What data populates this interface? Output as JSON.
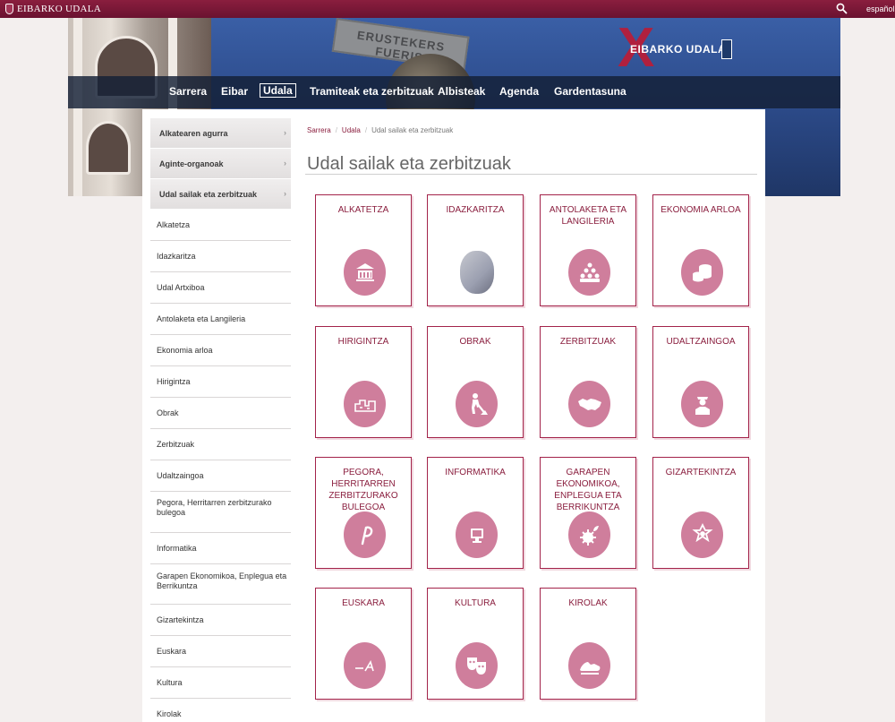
{
  "topbar": {
    "logo_text": "EIBARKO UDALA",
    "language": "español"
  },
  "banner": {
    "sign_text": "ERUSTEKERS FUERIS",
    "brand_text": "EIBARKO UDALA",
    "brand_mark": "X"
  },
  "nav": {
    "items": [
      {
        "label": "Sarrera"
      },
      {
        "label": "Eibar"
      },
      {
        "label": "Udala",
        "active": true
      },
      {
        "label": "Tramiteak eta zerbitzuak"
      },
      {
        "label": "Albisteak"
      },
      {
        "label": "Agenda"
      },
      {
        "label": "Gardentasuna"
      }
    ]
  },
  "sidebar": {
    "top_items": [
      {
        "label": "Alkatearen agurra"
      },
      {
        "label": "Aginte-organoak"
      },
      {
        "label": "Udal sailak eta zerbitzuak"
      }
    ],
    "sub_items": [
      {
        "label": "Alkatetza"
      },
      {
        "label": "Idazkaritza"
      },
      {
        "label": "Udal Artxiboa"
      },
      {
        "label": "Antolaketa eta Langileria"
      },
      {
        "label": "Ekonomia arloa"
      },
      {
        "label": "Hirigintza"
      },
      {
        "label": "Obrak"
      },
      {
        "label": "Zerbitzuak"
      },
      {
        "label": "Udaltzaingoa"
      },
      {
        "label": "Pegora, Herritarren zerbitzurako bulegoa"
      },
      {
        "label": "Informatika"
      },
      {
        "label": "Garapen Ekonomikoa, Enplegua eta Berrikuntza"
      },
      {
        "label": "Gizartekintza"
      },
      {
        "label": "Euskara"
      },
      {
        "label": "Kultura"
      },
      {
        "label": "Kirolak"
      }
    ]
  },
  "breadcrumb": {
    "home": "Sarrera",
    "parent": "Udala",
    "current": "Udal sailak eta zerbitzuak"
  },
  "page_title": "Udal sailak eta zerbitzuak",
  "tiles": [
    {
      "label": "ALKATETZA",
      "icon": "town-hall-icon"
    },
    {
      "label": "IDAZKARITZA",
      "icon": "document-photo"
    },
    {
      "label": "ANTOLAKETA ETA LANGILERIA",
      "icon": "people-pyramid-icon"
    },
    {
      "label": "EKONOMIA ARLOA",
      "icon": "coins-icon"
    },
    {
      "label": "HIRIGINTZA",
      "icon": "city-plan-icon"
    },
    {
      "label": "OBRAK",
      "icon": "worker-digging-icon"
    },
    {
      "label": "ZERBITZUAK",
      "icon": "handshake-icon"
    },
    {
      "label": "UDALTZAINGOA",
      "icon": "police-officer-icon"
    },
    {
      "label": "PEGORA, HERRITARREN ZERBITZURAKO BULEGOA",
      "icon": "pegora-logo-icon"
    },
    {
      "label": "INFORMATIKA",
      "icon": "computer-icon"
    },
    {
      "label": "GARAPEN EKONOMIKOA, ENPLEGUA ETA BERRIKUNTZA",
      "icon": "gear-sprout-icon"
    },
    {
      "label": "GIZARTEKINTZA",
      "icon": "community-star-icon"
    },
    {
      "label": "EUSKARA",
      "icon": "euskara-logo-icon"
    },
    {
      "label": "KULTURA",
      "icon": "theater-masks-icon"
    },
    {
      "label": "KIROLAK",
      "icon": "sneaker-icon"
    }
  ]
}
